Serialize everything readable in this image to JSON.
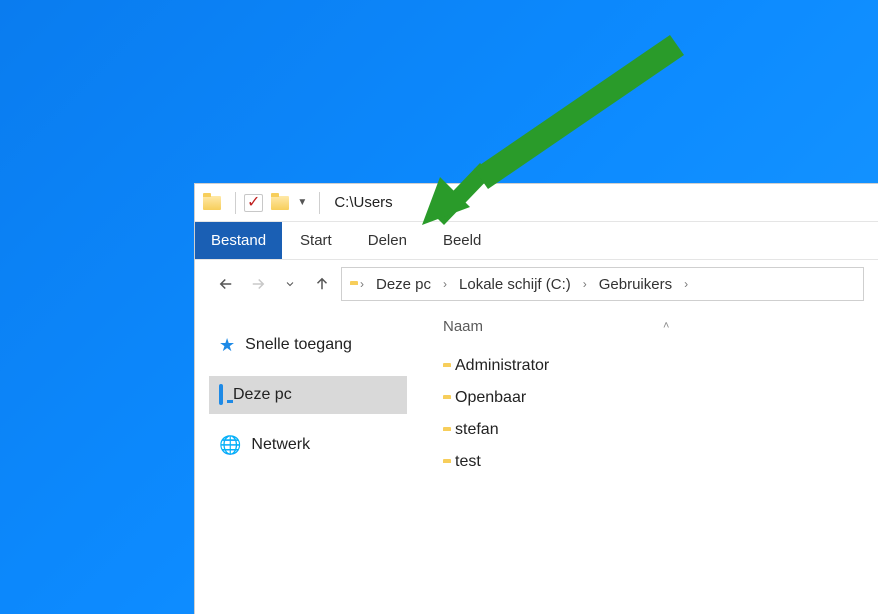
{
  "title": "C:\\Users",
  "ribbon": {
    "file": "Bestand",
    "home": "Start",
    "share": "Delen",
    "view": "Beeld"
  },
  "breadcrumb": {
    "seg1": "Deze pc",
    "seg2": "Lokale schijf (C:)",
    "seg3": "Gebruikers"
  },
  "sidebar": {
    "quick_access": "Snelle toegang",
    "this_pc": "Deze pc",
    "network": "Netwerk"
  },
  "column_header": "Naam",
  "files": {
    "f0": "Administrator",
    "f1": "Openbaar",
    "f2": "stefan",
    "f3": "test"
  }
}
